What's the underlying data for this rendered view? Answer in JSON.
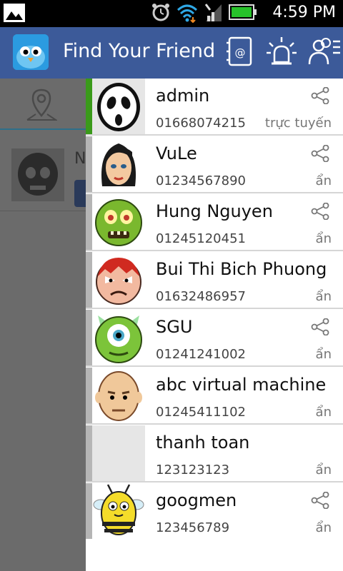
{
  "statusbar": {
    "time": "4:59 PM",
    "icons": [
      "image-notification-icon",
      "alarm-icon",
      "wifi-icon",
      "signal-icon",
      "battery-icon"
    ]
  },
  "actionbar": {
    "title": "Find Your Friend",
    "buttons": [
      "contacts-icon",
      "alert-siren-icon",
      "friends-menu-icon"
    ],
    "color": "#3c5a99"
  },
  "content": {
    "item_name_partial": "N"
  },
  "friends": [
    {
      "name": "admin",
      "phone": "01668074215",
      "status": "trực tuyến",
      "online": true,
      "share": true,
      "avatar": "ghost-face"
    },
    {
      "name": "VuLe",
      "phone": "01234567890",
      "status": "ẩn",
      "online": false,
      "share": true,
      "avatar": "woman-face"
    },
    {
      "name": "Hung Nguyen",
      "phone": "01245120451",
      "status": "ẩn",
      "online": false,
      "share": true,
      "avatar": "zombie-face"
    },
    {
      "name": "Bui Thi Bich Phuong",
      "phone": "01632486957",
      "status": "ẩn",
      "online": false,
      "share": true,
      "avatar": "angry-face"
    },
    {
      "name": "SGU",
      "phone": "01241241002",
      "status": "ẩn",
      "online": false,
      "share": true,
      "avatar": "one-eyed-monster"
    },
    {
      "name": "abc virtual machine",
      "phone": "01245411102",
      "status": "ẩn",
      "online": false,
      "share": true,
      "avatar": "bald-man"
    },
    {
      "name": "thanh toan",
      "phone": "123123123",
      "status": "ẩn",
      "online": false,
      "share": false,
      "avatar": "blank"
    },
    {
      "name": "googmen",
      "phone": "123456789",
      "status": "ẩn",
      "online": false,
      "share": true,
      "avatar": "bee"
    }
  ]
}
